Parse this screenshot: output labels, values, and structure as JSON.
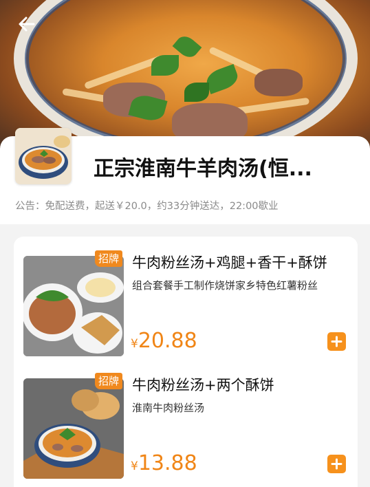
{
  "shop": {
    "name": "正宗淮南牛羊肉汤(恒...",
    "notice": "公告：免配送费，起送￥20.0，约33分钟送达，22:00歇业"
  },
  "items": [
    {
      "badge": "招牌",
      "title": "牛肉粉丝汤+鸡腿+香干+酥饼",
      "desc": "组合套餐手工制作烧饼家乡特色红薯粉丝",
      "currency": "¥",
      "price": "20.88"
    },
    {
      "badge": "招牌",
      "title": "牛肉粉丝汤+两个酥饼",
      "desc": "淮南牛肉粉丝汤",
      "currency": "¥",
      "price": "13.88"
    }
  ],
  "colors": {
    "accent": "#f08516",
    "badge": "#f0891e",
    "add_button": "#f6911c"
  },
  "icons": {
    "back": "arrow-left-icon",
    "add": "plus-icon"
  }
}
